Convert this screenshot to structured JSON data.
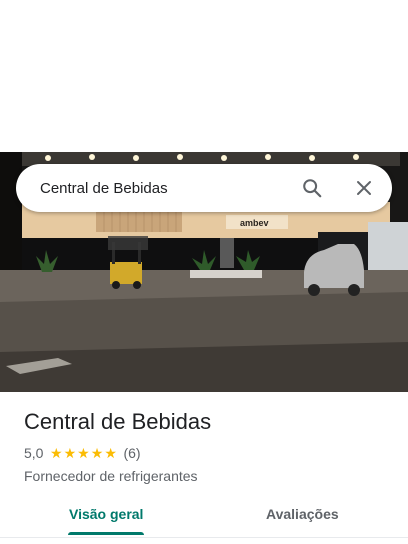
{
  "search": {
    "query": "Central de Bebidas"
  },
  "place": {
    "name": "Central de Bebidas",
    "rating": "5,0",
    "stars": 5,
    "review_count": "(6)",
    "category": "Fornecedor de refrigerantes"
  },
  "photo": {
    "signage_text": "ambev"
  },
  "tabs": [
    {
      "label": "Visão geral",
      "active": true
    },
    {
      "label": "Avaliações",
      "active": false
    }
  ],
  "colors": {
    "accent": "#00796b",
    "star": "#fbbc04"
  },
  "icons": {
    "search": "search-icon",
    "close": "close-icon",
    "star": "star-icon"
  }
}
